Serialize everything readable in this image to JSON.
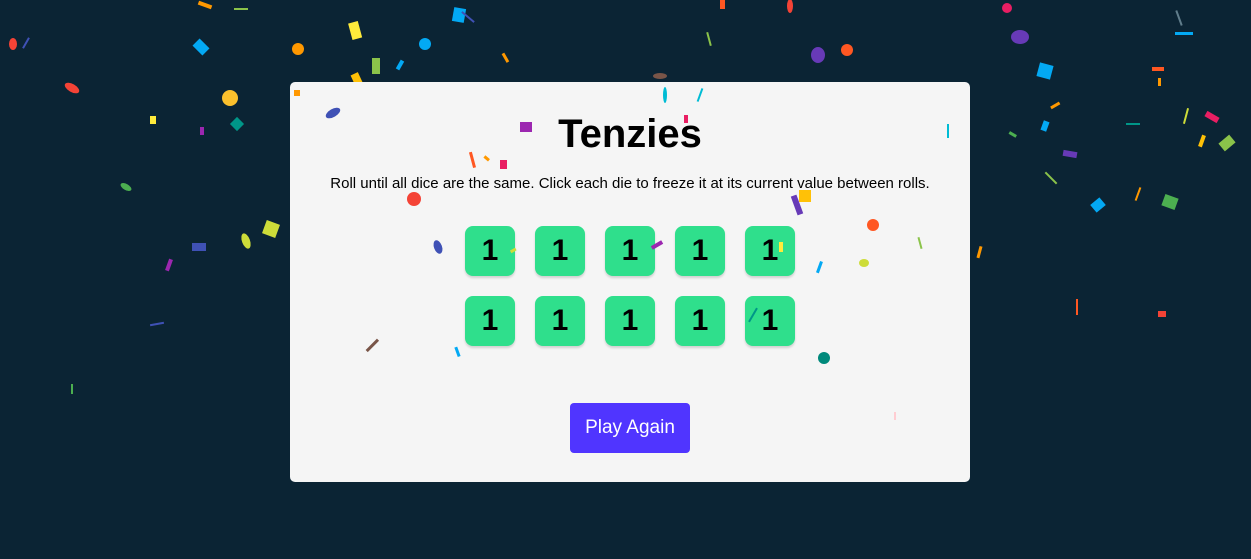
{
  "game": {
    "title": "Tenzies",
    "instructions": "Roll until all dice are the same. Click each die to freeze it at its current value between rolls.",
    "dice": [
      "1",
      "1",
      "1",
      "1",
      "1",
      "1",
      "1",
      "1",
      "1",
      "1"
    ],
    "play_button_label": "Play Again"
  },
  "colors": {
    "background": "#0b2434",
    "card": "#f5f5f5",
    "die_held": "#2fdf8c",
    "button": "#5035ff"
  }
}
